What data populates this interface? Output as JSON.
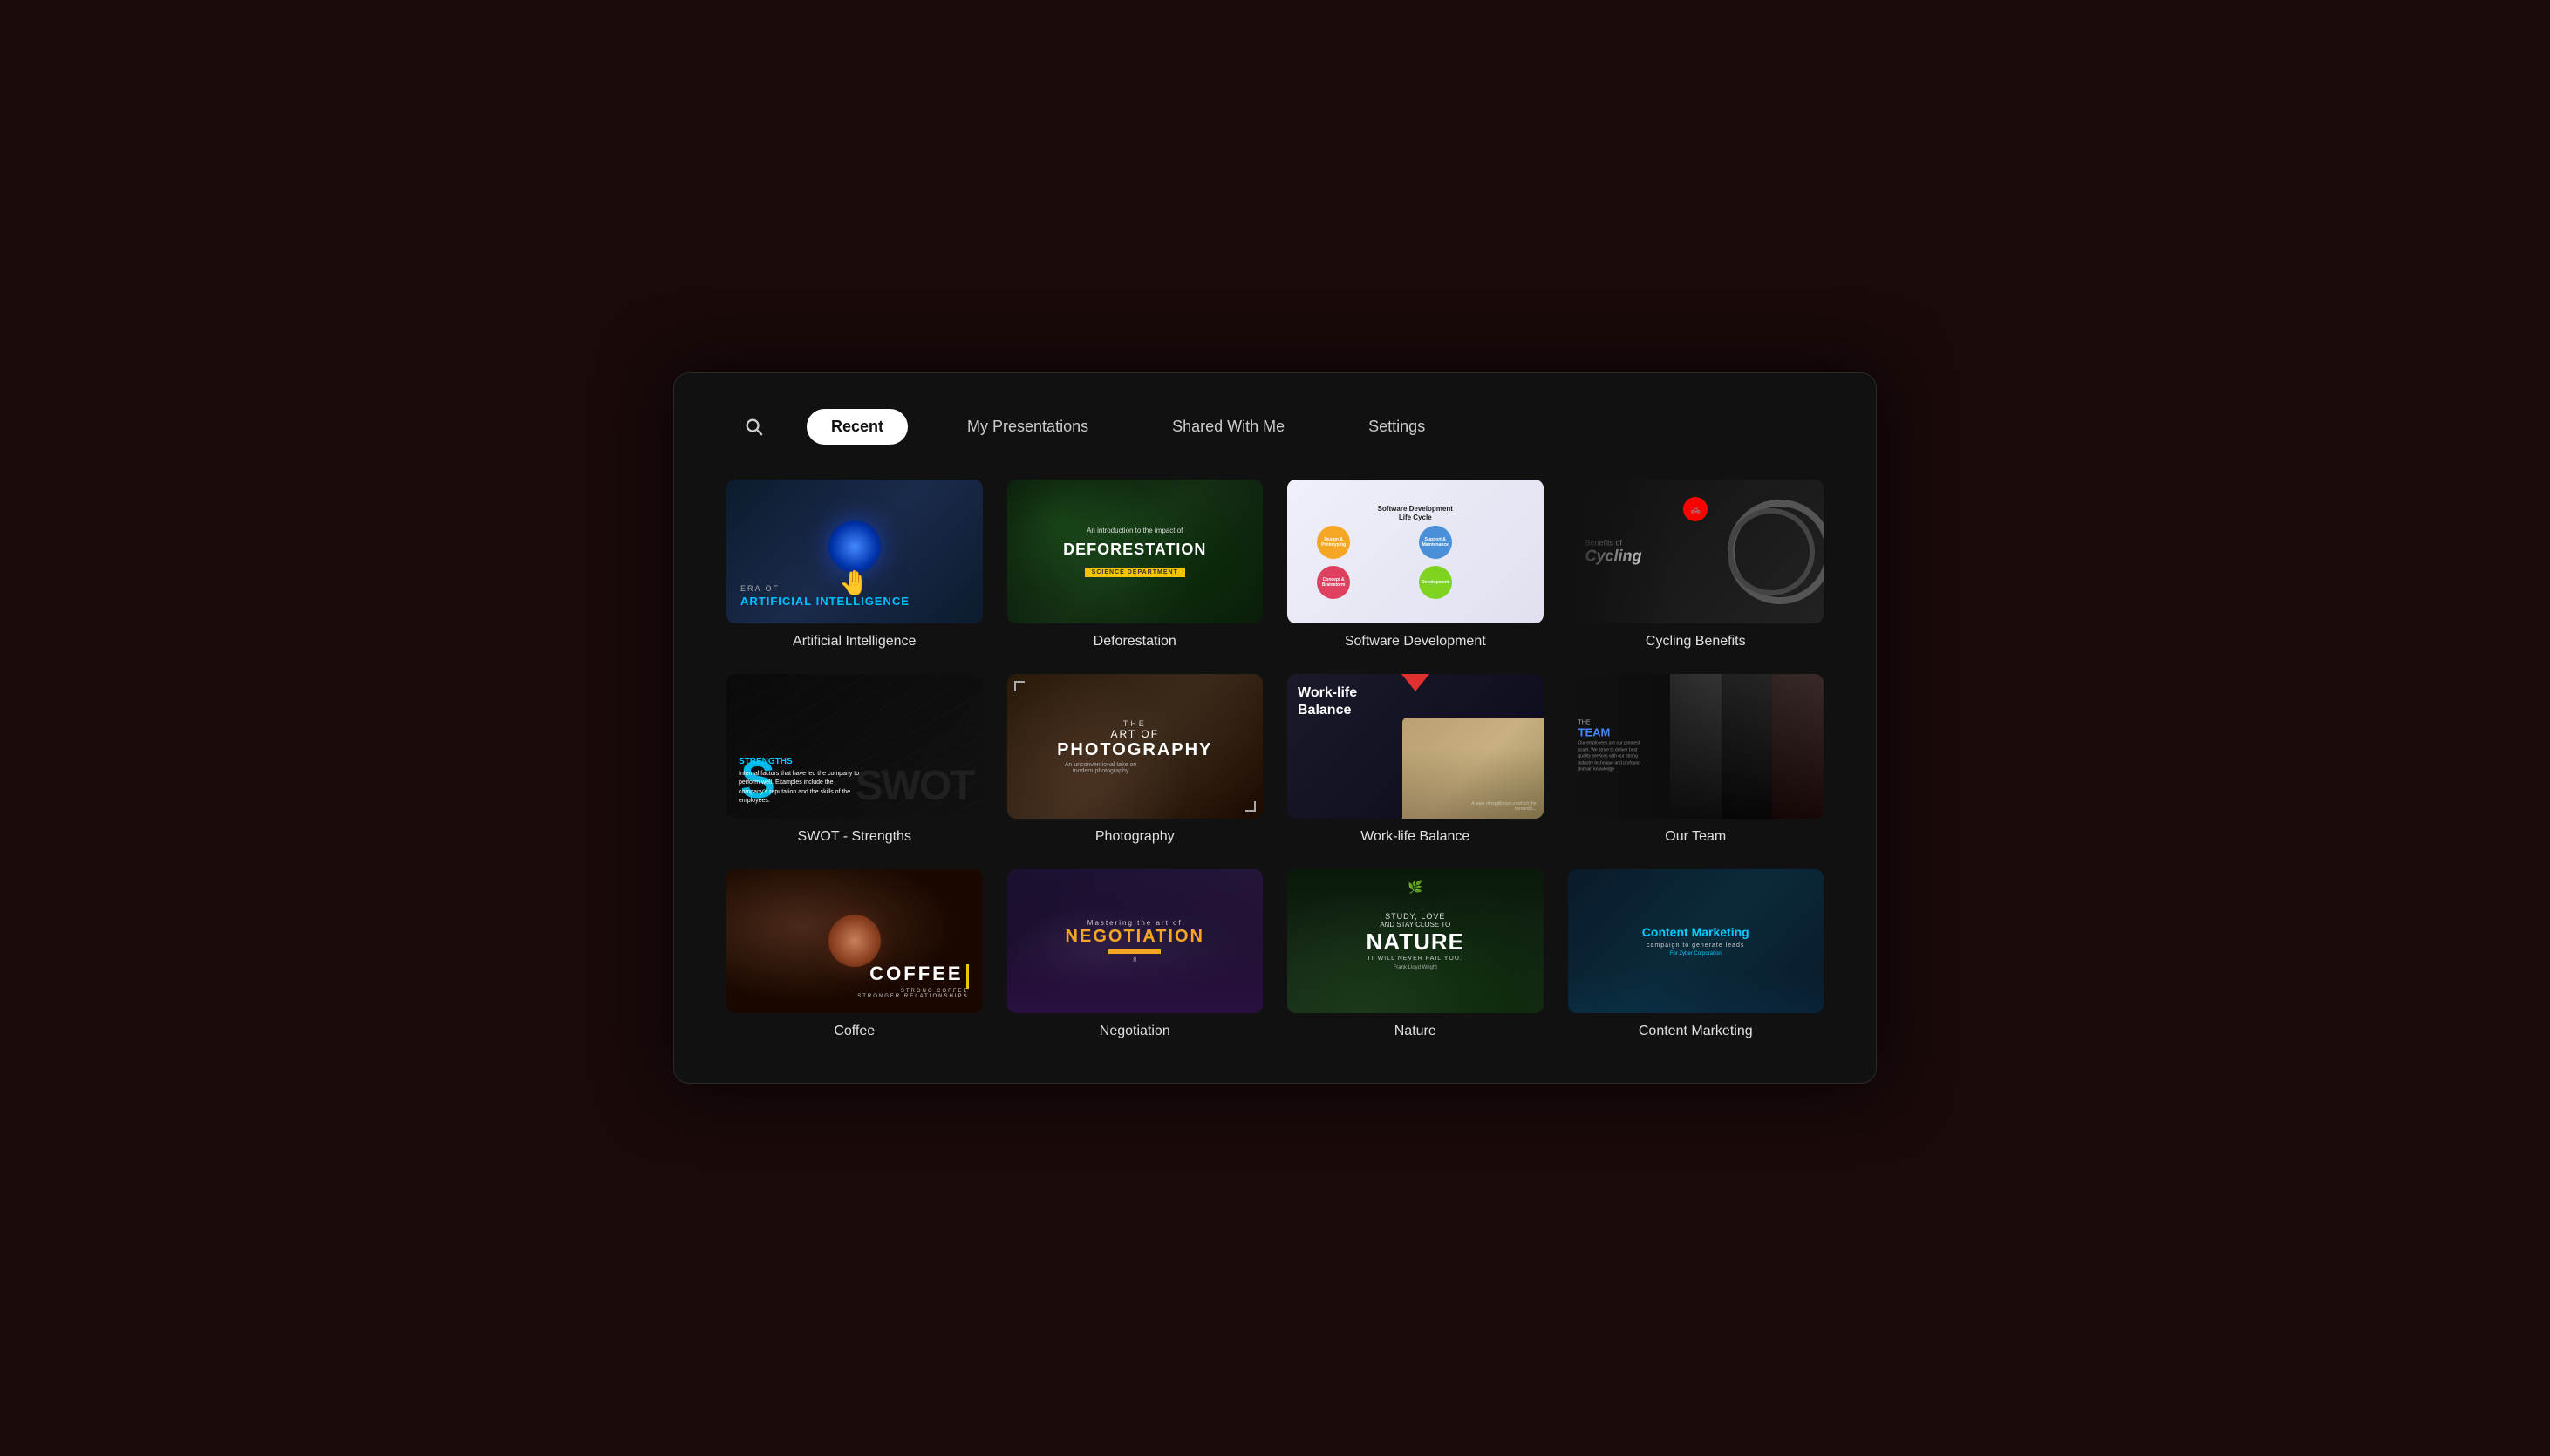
{
  "nav": {
    "search_icon": "🔍",
    "tabs": [
      {
        "id": "recent",
        "label": "Recent",
        "active": true
      },
      {
        "id": "my-presentations",
        "label": "My Presentations",
        "active": false
      },
      {
        "id": "shared-with-me",
        "label": "Shared With Me",
        "active": false
      },
      {
        "id": "settings",
        "label": "Settings",
        "active": false
      }
    ]
  },
  "cards": [
    {
      "id": "artificial-intelligence",
      "label": "Artificial Intelligence",
      "thumb_type": "ai"
    },
    {
      "id": "deforestation",
      "label": "Deforestation",
      "thumb_type": "deforestation"
    },
    {
      "id": "software-development",
      "label": "Software Development",
      "thumb_type": "software"
    },
    {
      "id": "cycling-benefits",
      "label": "Cycling Benefits",
      "thumb_type": "cycling"
    },
    {
      "id": "swot-strengths",
      "label": "SWOT - Strengths",
      "thumb_type": "swot"
    },
    {
      "id": "photography",
      "label": "Photography",
      "thumb_type": "photography"
    },
    {
      "id": "work-life-balance",
      "label": "Work-life Balance",
      "thumb_type": "worklife"
    },
    {
      "id": "our-team",
      "label": "Our Team",
      "thumb_type": "ourteam"
    },
    {
      "id": "coffee",
      "label": "Coffee",
      "thumb_type": "coffee"
    },
    {
      "id": "negotiation",
      "label": "Negotiation",
      "thumb_type": "negotiation"
    },
    {
      "id": "nature",
      "label": "Nature",
      "thumb_type": "nature"
    },
    {
      "id": "content-marketing",
      "label": "Content Marketing",
      "thumb_type": "content-marketing"
    }
  ],
  "thumbnails": {
    "ai": {
      "era_label": "ERA OF",
      "title": "ARTIFICIAL INTELLIGENCE"
    },
    "deforestation": {
      "intro": "An introduction to the impact of",
      "title": "DEFORESTATION",
      "tag": "SCIENCE DEPARTMENT"
    },
    "software": {
      "title": "Software Development",
      "subtitle": "Life Cycle",
      "circles": [
        {
          "color": "#f5a623",
          "label": "Design &\nPrototyping"
        },
        {
          "color": "#7ed321",
          "label": "Development &\nDeployment"
        },
        {
          "color": "#e04060",
          "label": "Concept &\nBrainstorming"
        },
        {
          "color": "#4a90d9",
          "label": "Support &\nMaintenance"
        }
      ]
    },
    "cycling": {
      "benefits_of": "Benefits of",
      "cycling": "Cycling"
    },
    "swot": {
      "strengths_label": "STRENGTHS",
      "description": "Internal factors that have led the company to perform well. Examples include the company's reputation and the skills of the employees.",
      "big_text": "SWOT"
    },
    "photography": {
      "the": "THE",
      "art_of": "ART OF",
      "title": "PHOTOGRAPHY",
      "subtitle": "An unconventional take on modern photography"
    },
    "worklife": {
      "line1": "Work-life",
      "line2": "Balance"
    },
    "ourteam": {
      "the": "THE",
      "title": "TEAM",
      "description": "Our employees are our greatest asset. We strive to deliver best quality services with our strong industry technique and profound domain knowledge"
    },
    "coffee": {
      "label": "COFFEE",
      "sub": "STRONG COFFEE\nSTRONGER RELATIONSHIPS"
    },
    "negotiation": {
      "mastering": "Mastering the art of",
      "title": "NEGOTIATION",
      "num": "8"
    },
    "nature": {
      "study": "STUDY, LOVE",
      "and_stay": "AND STAY CLOSE TO",
      "big": "NATURE",
      "tagline": "IT WILL NEVER FAIL YOU.",
      "author": "Frank Lloyd Wright"
    },
    "content_marketing": {
      "title": "Content Marketing",
      "sub": "campaign to generate leads",
      "corp": "For Zyber Corporation"
    }
  }
}
